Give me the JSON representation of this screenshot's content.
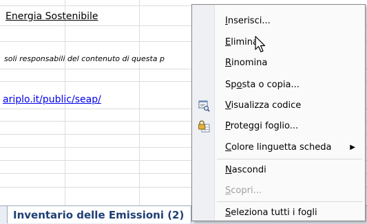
{
  "sheet": {
    "title": "Energia Sostenibile",
    "note": "soli responsabili del contenuto di questa p",
    "link": "ariplo.it/public/seap/",
    "active_tab": "Inventario delle Emissioni (2)"
  },
  "context_menu": {
    "items": [
      {
        "label_pre": "",
        "ukey": "I",
        "label_post": "nserisci...",
        "icon": "",
        "enabled": true
      },
      {
        "label_pre": "",
        "ukey": "E",
        "label_post": "limina",
        "icon": "",
        "enabled": true
      },
      {
        "label_pre": "",
        "ukey": "R",
        "label_post": "inomina",
        "icon": "",
        "enabled": true
      },
      {
        "label_pre": "Sp",
        "ukey": "o",
        "label_post": "sta o copia...",
        "icon": "",
        "enabled": true
      },
      {
        "label_pre": "",
        "ukey": "V",
        "label_post": "isualizza codice",
        "icon": "view-code-icon",
        "enabled": true
      },
      {
        "label_pre": "",
        "ukey": "P",
        "label_post": "roteggi foglio...",
        "icon": "protect-sheet-icon",
        "enabled": true
      },
      {
        "label_pre": "",
        "ukey": "C",
        "label_post": "olore linguetta scheda",
        "icon": "",
        "enabled": true,
        "submenu": true
      },
      {
        "label_pre": "",
        "ukey": "N",
        "label_post": "ascondi",
        "icon": "",
        "enabled": true
      },
      {
        "label_pre": "",
        "ukey": "S",
        "label_post": "copri...",
        "icon": "",
        "enabled": false
      },
      {
        "label_pre": "",
        "ukey": "S",
        "label_post": "eleziona tutti i fogli",
        "icon": "",
        "enabled": true
      }
    ]
  }
}
